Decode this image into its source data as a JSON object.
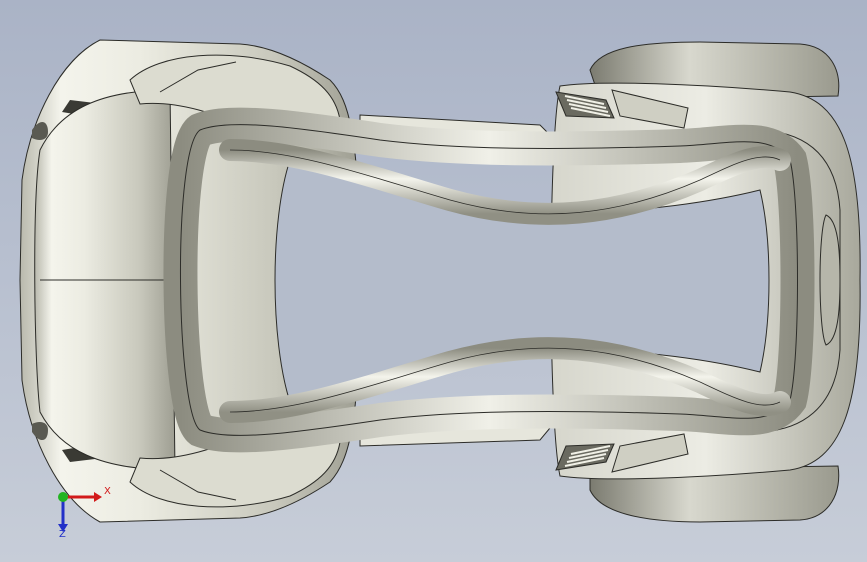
{
  "viewport": {
    "background_top": "#aab3c6",
    "background_bottom": "#c7cdd8"
  },
  "model": {
    "body_color": "#c9c9bd",
    "highlight_color": "#f2f2ea",
    "shadow_color": "#8a8a7e",
    "edge_color": "#2c2c28"
  },
  "triad": {
    "x_label": "X",
    "z_label": "Z",
    "x_color": "#d21a1a",
    "y_color": "#22b422",
    "z_color": "#2230c8"
  }
}
